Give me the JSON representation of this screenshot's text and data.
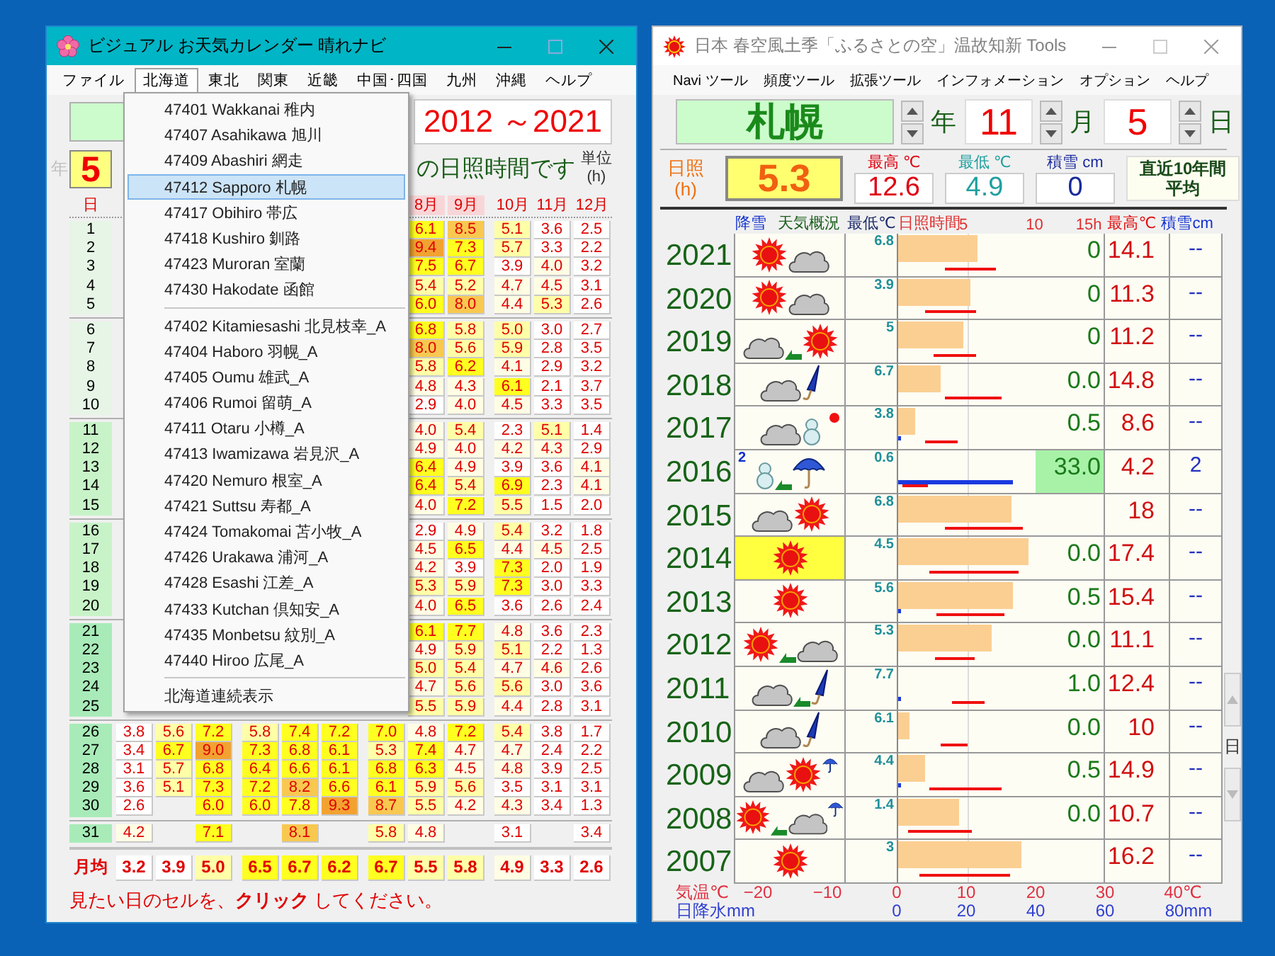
{
  "left_window": {
    "title": "ビジュアル お天気カレンダー 晴れナビ",
    "menu": [
      {
        "label": "ファイル",
        "selected": false
      },
      {
        "label": "北海道",
        "selected": true
      },
      {
        "label": "東北",
        "selected": false
      },
      {
        "label": "関東",
        "selected": false
      },
      {
        "label": "近畿",
        "selected": false
      },
      {
        "label": "中国･四国",
        "selected": false
      },
      {
        "label": "九州",
        "selected": false
      },
      {
        "label": "沖縄",
        "selected": false
      },
      {
        "label": "ヘルプ",
        "selected": false
      }
    ],
    "period": "2012 ～2021",
    "year_field": {
      "label": "年",
      "value": "5"
    },
    "heading": "の日照時間です",
    "unit_lines": [
      "単位",
      "(h)"
    ],
    "columns": [
      {
        "label": "日",
        "shaded": false
      },
      null,
      null,
      null,
      null,
      null,
      null,
      null,
      {
        "label": "8月",
        "shaded": true
      },
      {
        "label": "9月",
        "shaded": true
      },
      {
        "label": "10月",
        "shaded": false
      },
      {
        "label": "11月",
        "shaded": false
      },
      {
        "label": "12月",
        "shaded": false
      }
    ],
    "blocks": [
      {
        "rows": [
          {
            "day": "1",
            "cells": [
              null,
              null,
              null,
              null,
              null,
              null,
              null,
              "6.1",
              "8.5",
              "5.1",
              "3.6",
              "2.5"
            ]
          },
          {
            "day": "2",
            "cells": [
              null,
              null,
              null,
              null,
              null,
              null,
              null,
              "9.4",
              "7.3",
              "5.7",
              "3.3",
              "2.2"
            ]
          },
          {
            "day": "3",
            "cells": [
              null,
              null,
              null,
              null,
              null,
              null,
              null,
              "7.5",
              "6.7",
              "3.9",
              "4.0",
              "3.2"
            ]
          },
          {
            "day": "4",
            "cells": [
              null,
              null,
              null,
              null,
              null,
              null,
              null,
              "5.4",
              "5.2",
              "4.7",
              "4.5",
              "3.1"
            ]
          },
          {
            "day": "5",
            "cells": [
              null,
              null,
              null,
              null,
              null,
              null,
              null,
              "6.0",
              "8.0",
              "4.4",
              "5.3",
              "2.6"
            ]
          }
        ]
      },
      {
        "rows": [
          {
            "day": "6",
            "cells": [
              null,
              null,
              null,
              null,
              null,
              null,
              null,
              "6.8",
              "5.8",
              "5.0",
              "3.0",
              "2.7"
            ]
          },
          {
            "day": "7",
            "cells": [
              null,
              null,
              null,
              null,
              null,
              null,
              null,
              "8.0",
              "5.6",
              "5.9",
              "2.8",
              "3.5"
            ]
          },
          {
            "day": "8",
            "cells": [
              null,
              null,
              null,
              null,
              null,
              null,
              null,
              "5.8",
              "6.2",
              "4.1",
              "2.9",
              "3.2"
            ]
          },
          {
            "day": "9",
            "cells": [
              null,
              null,
              null,
              null,
              null,
              null,
              null,
              "4.8",
              "4.3",
              "6.1",
              "2.1",
              "3.7"
            ]
          },
          {
            "day": "10",
            "cells": [
              null,
              null,
              null,
              null,
              null,
              null,
              null,
              "2.9",
              "4.0",
              "4.5",
              "3.3",
              "3.5"
            ]
          }
        ]
      },
      {
        "rows": [
          {
            "day": "11",
            "cells": [
              null,
              null,
              null,
              null,
              null,
              null,
              null,
              "4.0",
              "5.4",
              "2.3",
              "5.1",
              "1.4"
            ]
          },
          {
            "day": "12",
            "cells": [
              null,
              null,
              null,
              null,
              null,
              null,
              null,
              "4.9",
              "4.0",
              "4.2",
              "4.3",
              "2.9"
            ]
          },
          {
            "day": "13",
            "cells": [
              null,
              null,
              null,
              null,
              null,
              null,
              null,
              "6.4",
              "4.9",
              "3.9",
              "3.6",
              "4.1"
            ]
          },
          {
            "day": "14",
            "cells": [
              null,
              null,
              null,
              null,
              null,
              null,
              null,
              "6.4",
              "5.4",
              "6.9",
              "2.3",
              "4.1"
            ]
          },
          {
            "day": "15",
            "cells": [
              null,
              null,
              null,
              null,
              null,
              null,
              null,
              "4.0",
              "7.2",
              "5.5",
              "1.5",
              "2.0"
            ]
          }
        ]
      },
      {
        "rows": [
          {
            "day": "16",
            "cells": [
              null,
              null,
              null,
              null,
              null,
              null,
              null,
              "2.9",
              "4.9",
              "5.4",
              "3.2",
              "1.8"
            ]
          },
          {
            "day": "17",
            "cells": [
              null,
              null,
              null,
              null,
              null,
              null,
              null,
              "4.5",
              "6.5",
              "4.4",
              "4.5",
              "2.5"
            ]
          },
          {
            "day": "18",
            "cells": [
              null,
              null,
              null,
              null,
              null,
              null,
              null,
              "4.2",
              "3.9",
              "7.3",
              "2.0",
              "1.9"
            ]
          },
          {
            "day": "19",
            "cells": [
              null,
              null,
              null,
              null,
              null,
              null,
              null,
              "5.3",
              "5.9",
              "7.3",
              "3.0",
              "3.3"
            ]
          },
          {
            "day": "20",
            "cells": [
              null,
              null,
              null,
              null,
              null,
              null,
              null,
              "4.0",
              "6.5",
              "3.6",
              "2.6",
              "2.4"
            ]
          }
        ]
      },
      {
        "rows": [
          {
            "day": "21",
            "cells": [
              null,
              null,
              null,
              null,
              null,
              null,
              null,
              "6.1",
              "7.7",
              "4.8",
              "3.6",
              "2.3"
            ]
          },
          {
            "day": "22",
            "cells": [
              null,
              null,
              null,
              null,
              null,
              null,
              null,
              "4.9",
              "5.9",
              "5.1",
              "2.2",
              "1.3"
            ]
          },
          {
            "day": "23",
            "cells": [
              null,
              null,
              null,
              null,
              null,
              null,
              null,
              "5.0",
              "5.4",
              "4.7",
              "4.6",
              "2.6"
            ]
          },
          {
            "day": "24",
            "cells": [
              null,
              null,
              null,
              null,
              null,
              null,
              null,
              "4.7",
              "5.6",
              "5.6",
              "3.0",
              "3.6"
            ]
          },
          {
            "day": "25",
            "cells": [
              null,
              null,
              null,
              null,
              null,
              null,
              null,
              "5.5",
              "5.9",
              "4.4",
              "2.8",
              "3.1"
            ]
          }
        ]
      },
      {
        "rows": [
          {
            "day": "26",
            "cells": [
              "3.8",
              "5.6",
              "7.2",
              "5.8",
              "7.4",
              "7.2",
              "7.0",
              "4.8",
              "7.2",
              "5.4",
              "3.8",
              "1.7"
            ]
          },
          {
            "day": "27",
            "cells": [
              "3.4",
              "6.7",
              "9.0",
              "7.3",
              "6.8",
              "6.1",
              "5.3",
              "7.4",
              "4.7",
              "4.7",
              "2.4",
              "2.2"
            ]
          },
          {
            "day": "28",
            "cells": [
              "3.1",
              "5.7",
              "6.8",
              "6.4",
              "6.6",
              "6.1",
              "6.8",
              "6.3",
              "4.5",
              "4.8",
              "3.9",
              "2.5"
            ]
          },
          {
            "day": "29",
            "cells": [
              "3.6",
              "5.1",
              "7.3",
              "7.2",
              "8.2",
              "6.6",
              "6.1",
              "5.9",
              "5.6",
              "3.5",
              "3.1",
              "3.1"
            ]
          },
          {
            "day": "30",
            "cells": [
              "2.6",
              null,
              "6.0",
              "6.0",
              "7.8",
              "9.3",
              "8.7",
              "5.5",
              "4.2",
              "4.3",
              "3.4",
              "1.3"
            ]
          }
        ]
      },
      {
        "rows": [
          {
            "day": "31",
            "cells": [
              "4.2",
              null,
              "7.1",
              null,
              "8.1",
              null,
              "5.8",
              "4.8",
              null,
              "3.1",
              null,
              "3.4"
            ]
          }
        ]
      }
    ],
    "average": {
      "label": "月均",
      "cells": [
        "3.2",
        "3.9",
        "5.0",
        "6.5",
        "6.7",
        "6.2",
        "6.7",
        "5.5",
        "5.8",
        "4.9",
        "3.3",
        "2.6"
      ]
    },
    "footer": "見たい日のセルを、**クリック** してください。",
    "dropdown": {
      "groups": [
        [
          {
            "text": "47401 Wakkanai 稚内",
            "selected": false
          },
          {
            "text": "47407 Asahikawa 旭川",
            "selected": false
          },
          {
            "text": "47409 Abashiri 網走",
            "selected": false
          },
          {
            "text": "47412 Sapporo 札幌",
            "selected": true
          },
          {
            "text": "47417 Obihiro 帯広",
            "selected": false
          },
          {
            "text": "47418 Kushiro 釧路",
            "selected": false
          },
          {
            "text": "47423 Muroran 室蘭",
            "selected": false
          },
          {
            "text": "47430 Hakodate 函館",
            "selected": false
          }
        ],
        [
          {
            "text": "47402 Kitamiesashi 北見枝幸_A",
            "selected": false
          },
          {
            "text": "47404 Haboro 羽幌_A",
            "selected": false
          },
          {
            "text": "47405 Oumu 雄武_A",
            "selected": false
          },
          {
            "text": "47406 Rumoi 留萌_A",
            "selected": false
          },
          {
            "text": "47411 Otaru 小樽_A",
            "selected": false
          },
          {
            "text": "47413 Iwamizawa 岩見沢_A",
            "selected": false
          },
          {
            "text": "47420 Nemuro 根室_A",
            "selected": false
          },
          {
            "text": "47421 Suttsu 寿都_A",
            "selected": false
          },
          {
            "text": "47424 Tomakomai 苫小牧_A",
            "selected": false
          },
          {
            "text": "47426 Urakawa 浦河_A",
            "selected": false
          },
          {
            "text": "47428 Esashi 江差_A",
            "selected": false
          },
          {
            "text": "47433 Kutchan 倶知安_A",
            "selected": false
          },
          {
            "text": "47435 Monbetsu 紋別_A",
            "selected": false
          },
          {
            "text": "47440 Hiroo 広尾_A",
            "selected": false
          }
        ],
        [
          {
            "text": "北海道連続表示",
            "selected": false
          }
        ]
      ]
    }
  },
  "right_window": {
    "title": "日本 春空風土季「ふるさとの空」温故知新  Tools",
    "menu": [
      "Navi ツール",
      "頻度ツール",
      "拡張ツール",
      "インフォメーション",
      "オプション",
      "ヘルプ"
    ],
    "station": "札幌",
    "year_label": "年",
    "month": {
      "value": "11",
      "label": "月"
    },
    "day": {
      "value": "5",
      "label": "日"
    },
    "summary": {
      "sunshine_label_lines": [
        "日照",
        "(h)"
      ],
      "sunshine": "5.3",
      "high": {
        "label": "最高 ℃",
        "value": "12.6"
      },
      "low": {
        "label": "最低 ℃",
        "value": "4.9"
      },
      "snow": {
        "label": "積雪 cm",
        "value": "0"
      },
      "average_button_lines": [
        "直近10年間",
        "平均"
      ]
    },
    "header": {
      "snowfall": "降雪",
      "weather": "天気概況",
      "low": "最低℃",
      "sunshine": "日照時間",
      "ticks": [
        "5",
        "10",
        "15h"
      ],
      "high": "最高℃",
      "snow_depth": "積雪cm"
    },
    "rows": [
      {
        "year": "2021",
        "icons": [
          {
            "kind": "sun"
          },
          {
            "kind": "cloud"
          }
        ],
        "highlighted": false,
        "alert": false,
        "low": "6.8",
        "level": 0.58,
        "precip": "0",
        "precip_marked": false,
        "high": "14.1",
        "snow": "--"
      },
      {
        "year": "2020",
        "icons": [
          {
            "kind": "sun"
          },
          {
            "kind": "cloud"
          }
        ],
        "highlighted": false,
        "alert": false,
        "low": "3.9",
        "level": 0.53,
        "precip": "0",
        "precip_marked": false,
        "high": "11.3",
        "snow": "--"
      },
      {
        "year": "2019",
        "icons": [
          {
            "kind": "cloud"
          },
          {
            "kind": "arrow"
          },
          {
            "kind": "sun"
          }
        ],
        "highlighted": false,
        "alert": false,
        "low": "5",
        "level": 0.47,
        "precip": "0",
        "precip_marked": false,
        "high": "11.2",
        "snow": "--"
      },
      {
        "year": "2018",
        "icons": [
          {
            "kind": "cloud"
          },
          {
            "kind": "closed_umbrella"
          }
        ],
        "highlighted": false,
        "alert": false,
        "low": "6.7",
        "level": 0.31,
        "precip": "0.0",
        "precip_marked": false,
        "high": "14.8",
        "snow": "--"
      },
      {
        "year": "2017",
        "icons": [
          {
            "kind": "cloud"
          },
          {
            "kind": "snowman"
          }
        ],
        "highlighted": false,
        "alert": true,
        "low": "3.8",
        "level": 0.12,
        "precip": "0.5",
        "precip_marked": false,
        "high": "8.6",
        "snow": "--"
      },
      {
        "year": "2016",
        "snowfall": "2",
        "icons": [
          {
            "kind": "snowman"
          },
          {
            "kind": "arrow"
          },
          {
            "kind": "umbrella"
          }
        ],
        "highlighted": false,
        "alert": false,
        "low": "0.6",
        "precip": "33.0",
        "precip_marked": true,
        "high": "4.2",
        "snow": "2"
      },
      {
        "year": "2015",
        "icons": [
          {
            "kind": "cloud"
          },
          {
            "kind": "sun"
          }
        ],
        "highlighted": false,
        "alert": false,
        "low": "6.8",
        "level": 0.82,
        "precip_marked": false,
        "high": "18",
        "snow": "--"
      },
      {
        "year": "2014",
        "icons": [
          {
            "kind": "sun"
          }
        ],
        "highlighted": true,
        "alert": false,
        "low": "4.5",
        "level": 0.95,
        "precip": "0.0",
        "precip_marked": false,
        "high": "17.4",
        "snow": "--"
      },
      {
        "year": "2013",
        "icons": [
          {
            "kind": "sun"
          }
        ],
        "highlighted": false,
        "alert": false,
        "low": "5.6",
        "level": 0.84,
        "precip": "0.5",
        "precip_marked": false,
        "high": "15.4",
        "snow": "--"
      },
      {
        "year": "2012",
        "icons": [
          {
            "kind": "sun"
          },
          {
            "kind": "arrow"
          },
          {
            "kind": "cloud"
          }
        ],
        "highlighted": false,
        "alert": false,
        "low": "5.3",
        "level": 0.68,
        "precip": "0.0",
        "precip_marked": false,
        "high": "11.1",
        "snow": "--"
      },
      {
        "year": "2011",
        "icons": [
          {
            "kind": "cloud"
          },
          {
            "kind": "arrow"
          },
          {
            "kind": "closed_umbrella"
          }
        ],
        "highlighted": false,
        "alert": false,
        "low": "7.7",
        "precip": "1.0",
        "precip_marked": false,
        "high": "12.4",
        "snow": "--"
      },
      {
        "year": "2010",
        "icons": [
          {
            "kind": "cloud"
          },
          {
            "kind": "closed_umbrella"
          }
        ],
        "highlighted": false,
        "alert": false,
        "low": "6.1",
        "level": 0.08,
        "precip": "0.0",
        "precip_marked": false,
        "high": "10",
        "snow": "--"
      },
      {
        "year": "2009",
        "icons": [
          {
            "kind": "cloud"
          },
          {
            "kind": "sun"
          },
          {
            "kind": "small_umbrella"
          }
        ],
        "highlighted": false,
        "alert": false,
        "low": "4.4",
        "level": 0.2,
        "precip": "0.5",
        "precip_marked": false,
        "high": "14.9",
        "snow": "--"
      },
      {
        "year": "2008",
        "icons": [
          {
            "kind": "sun"
          },
          {
            "kind": "arrow"
          },
          {
            "kind": "cloud"
          },
          {
            "kind": "small_umbrella"
          }
        ],
        "highlighted": false,
        "alert": false,
        "low": "1.4",
        "level": 0.44,
        "precip": "0.0",
        "precip_marked": false,
        "high": "10.7",
        "snow": "--"
      },
      {
        "year": "2007",
        "icons": [
          {
            "kind": "sun"
          }
        ],
        "highlighted": false,
        "alert": false,
        "low": "3",
        "level": 0.9,
        "precip_marked": false,
        "high": "16.2",
        "snow": "--"
      }
    ],
    "axis": {
      "temp_label": "気温℃",
      "temp_ticks": [
        "−20",
        "−10",
        "0",
        "10",
        "20",
        "30",
        "40℃"
      ],
      "precip_label": "日降水mm",
      "precip_ticks": [
        "0",
        "20",
        "40",
        "60",
        "80mm"
      ]
    },
    "side_spinner": {
      "label": "日"
    }
  }
}
